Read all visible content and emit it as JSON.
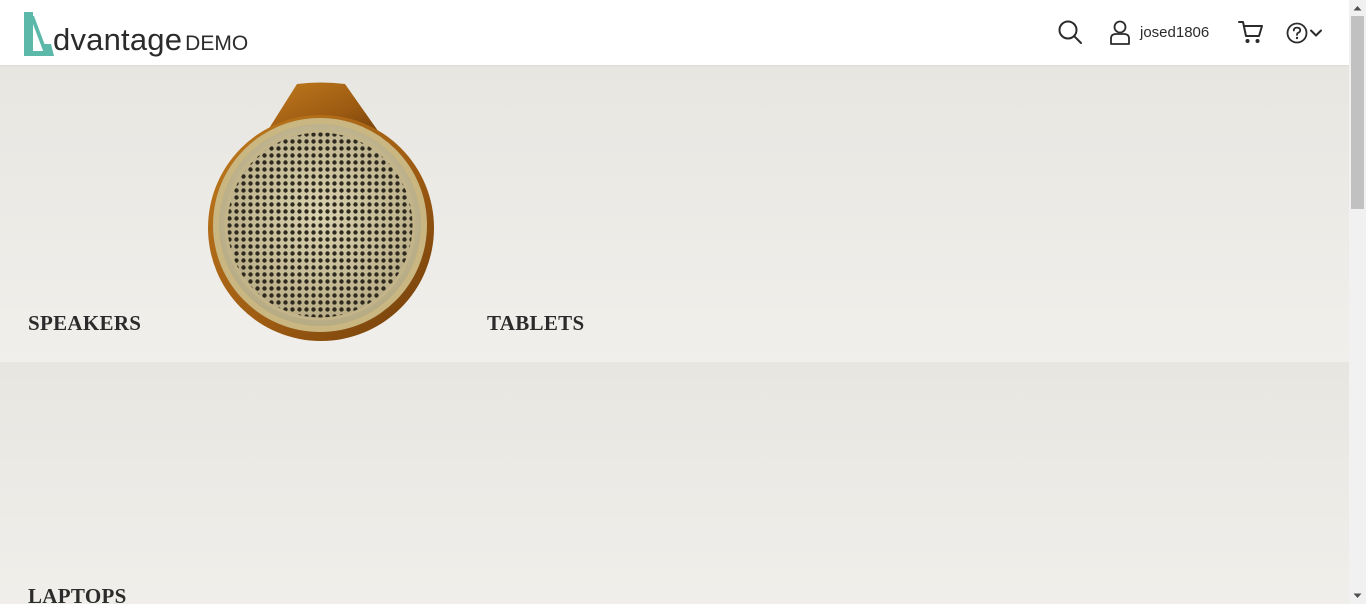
{
  "header": {
    "logo_word": "dvantage",
    "logo_suffix": "DEMO",
    "username": "josed1806"
  },
  "icons": {
    "search": "search-icon",
    "user": "user-icon",
    "cart": "cart-icon",
    "help": "help-icon",
    "dropdown": "chevron-down-icon"
  },
  "categories": {
    "speakers": "SPEAKERS",
    "tablets": "TABLETS",
    "laptops": "LAPTOPS"
  },
  "colors": {
    "brand": "#5cb8a8",
    "text": "#2b2b2b",
    "banner": "#ebe9e4"
  }
}
